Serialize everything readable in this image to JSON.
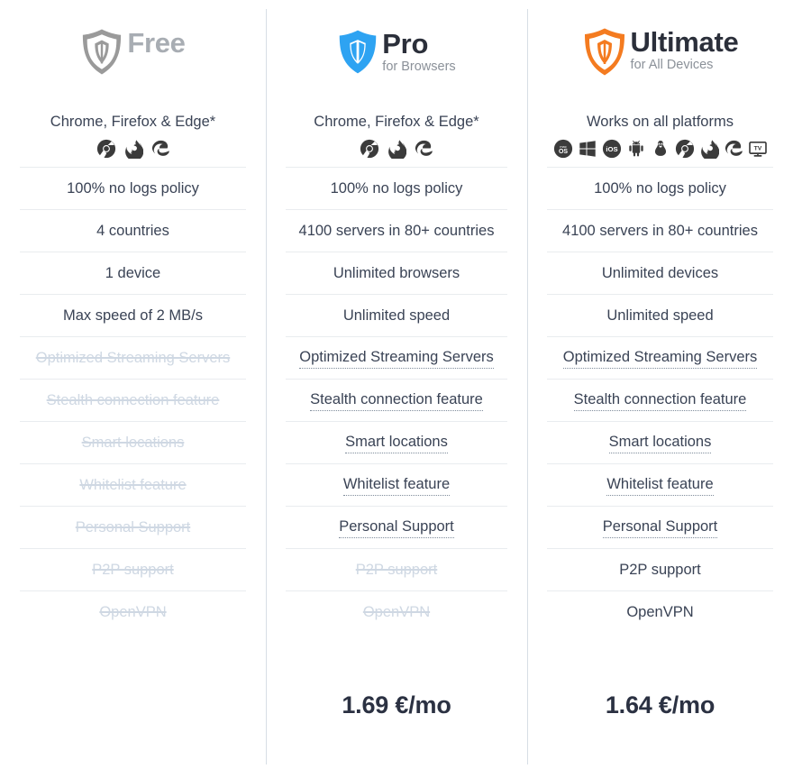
{
  "columns": [
    {
      "id": "free",
      "name": "Free",
      "subtitle": "",
      "shield_color": "#9a9a9a",
      "shield_style": "outline",
      "title_color": "#a8adb3",
      "platform_text": "Chrome, Firefox & Edge*",
      "platform_icons": [
        "chrome-icon",
        "firefox-icon",
        "edge-icon"
      ],
      "price": "",
      "features": [
        {
          "label": "100% no logs policy",
          "state": "on"
        },
        {
          "label": "4 countries",
          "state": "on"
        },
        {
          "label": "1 device",
          "state": "on"
        },
        {
          "label": "Max speed of 2 MB/s",
          "state": "on"
        },
        {
          "label": "Optimized Streaming Servers",
          "state": "off"
        },
        {
          "label": "Stealth connection feature",
          "state": "off"
        },
        {
          "label": "Smart locations",
          "state": "off"
        },
        {
          "label": "Whitelist feature",
          "state": "off"
        },
        {
          "label": "Personal Support",
          "state": "off"
        },
        {
          "label": "P2P support",
          "state": "off"
        },
        {
          "label": "OpenVPN",
          "state": "off"
        }
      ]
    },
    {
      "id": "pro",
      "name": "Pro",
      "subtitle": "for Browsers",
      "shield_color": "#2ea3f2",
      "shield_style": "filled",
      "title_color": "#2b2f3a",
      "platform_text": "Chrome, Firefox & Edge*",
      "platform_icons": [
        "chrome-icon",
        "firefox-icon",
        "edge-icon"
      ],
      "price": "1.69 €/mo",
      "features": [
        {
          "label": "100% no logs policy",
          "state": "on"
        },
        {
          "label": "4100 servers in 80+ countries",
          "state": "on"
        },
        {
          "label": "Unlimited browsers",
          "state": "on"
        },
        {
          "label": "Unlimited speed",
          "state": "on"
        },
        {
          "label": "Optimized Streaming Servers",
          "state": "hint"
        },
        {
          "label": "Stealth connection feature",
          "state": "hint"
        },
        {
          "label": "Smart locations",
          "state": "hint"
        },
        {
          "label": "Whitelist feature",
          "state": "hint"
        },
        {
          "label": "Personal Support",
          "state": "hint"
        },
        {
          "label": "P2P support",
          "state": "off"
        },
        {
          "label": "OpenVPN",
          "state": "off"
        }
      ]
    },
    {
      "id": "ultimate",
      "name": "Ultimate",
      "subtitle": "for All Devices",
      "shield_color": "#f47b20",
      "shield_style": "outline",
      "title_color": "#2b2f3a",
      "platform_text": "Works on all platforms",
      "platform_icons": [
        "macos-icon",
        "windows-icon",
        "ios-icon",
        "android-icon",
        "linux-icon",
        "chrome-icon",
        "firefox-icon",
        "edge-icon",
        "tv-icon"
      ],
      "price": "1.64 €/mo",
      "features": [
        {
          "label": "100% no logs policy",
          "state": "on"
        },
        {
          "label": "4100 servers in 80+ countries",
          "state": "on"
        },
        {
          "label": "Unlimited devices",
          "state": "on"
        },
        {
          "label": "Unlimited speed",
          "state": "on"
        },
        {
          "label": "Optimized Streaming Servers",
          "state": "hint"
        },
        {
          "label": "Stealth connection feature",
          "state": "hint"
        },
        {
          "label": "Smart locations",
          "state": "hint"
        },
        {
          "label": "Whitelist feature",
          "state": "hint"
        },
        {
          "label": "Personal Support",
          "state": "hint"
        },
        {
          "label": "P2P support",
          "state": "on"
        },
        {
          "label": "OpenVPN",
          "state": "on"
        }
      ]
    }
  ],
  "colors": {
    "divider": "#d7dee5",
    "row_line": "#e9ecef",
    "text": "#3a4355",
    "disabled": "#cfd8e3",
    "icon": "#3b3b3b"
  }
}
